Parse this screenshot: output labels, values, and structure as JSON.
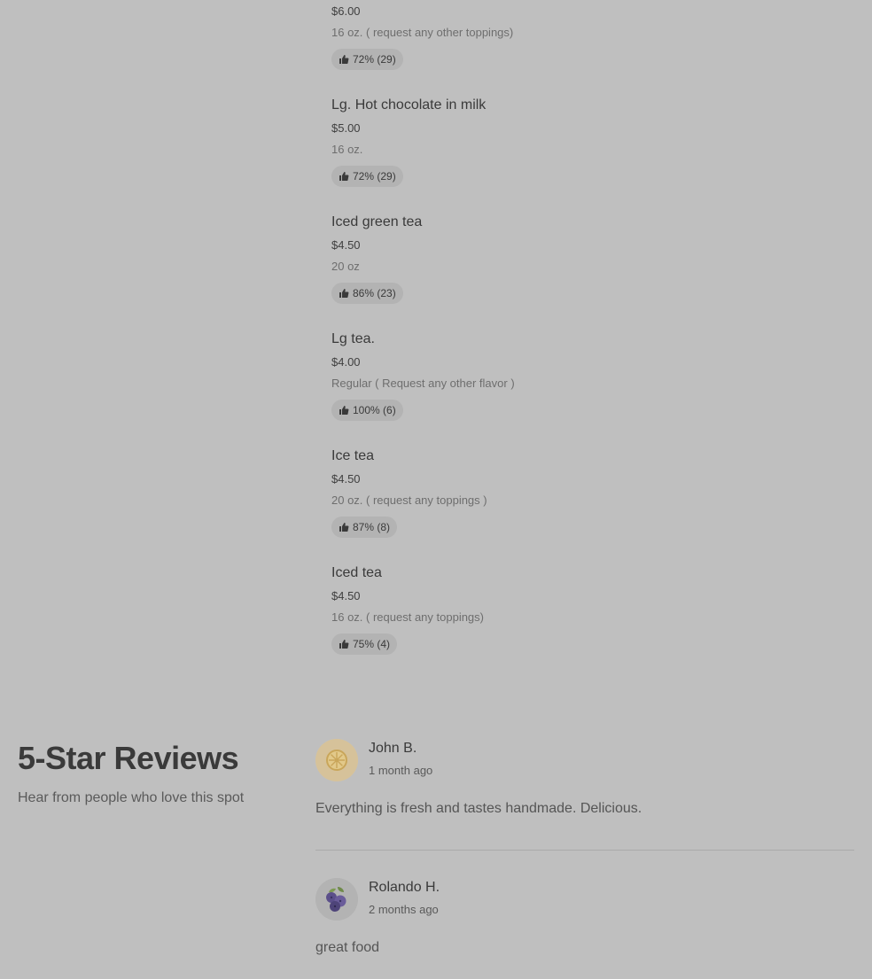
{
  "menu_items": [
    {
      "name": "",
      "price": "$6.00",
      "desc": "16 oz. ( request any other toppings)",
      "rating": "72% (29)"
    },
    {
      "name": "Lg. Hot chocolate in milk",
      "price": "$5.00",
      "desc": "16 oz.",
      "rating": "72% (29)"
    },
    {
      "name": "Iced green tea",
      "price": "$4.50",
      "desc": "20 oz",
      "rating": "86% (23)"
    },
    {
      "name": "Lg tea.",
      "price": "$4.00",
      "desc": "Regular ( Request any other flavor )",
      "rating": "100% (6)"
    },
    {
      "name": "Ice tea",
      "price": "$4.50",
      "desc": "20 oz. ( request any toppings )",
      "rating": "87% (8)"
    },
    {
      "name": "Iced tea",
      "price": "$4.50",
      "desc": "16 oz. ( request any toppings)",
      "rating": "75% (4)"
    }
  ],
  "reviews_section": {
    "title": "5-Star Reviews",
    "subtitle": "Hear from people who love this spot"
  },
  "reviews": [
    {
      "name": "John B.",
      "time": "1 month ago",
      "text": "Everything is fresh and tastes handmade. Delicious.",
      "avatar_icon": "lemon-icon",
      "avatar_color": "#d9c8a0"
    },
    {
      "name": "Rolando H.",
      "time": "2 months ago",
      "text": "great food",
      "avatar_icon": "blueberry-icon",
      "avatar_color": "#b3b3b3"
    }
  ],
  "icons": {
    "rating": "thumbs-up-icon"
  }
}
